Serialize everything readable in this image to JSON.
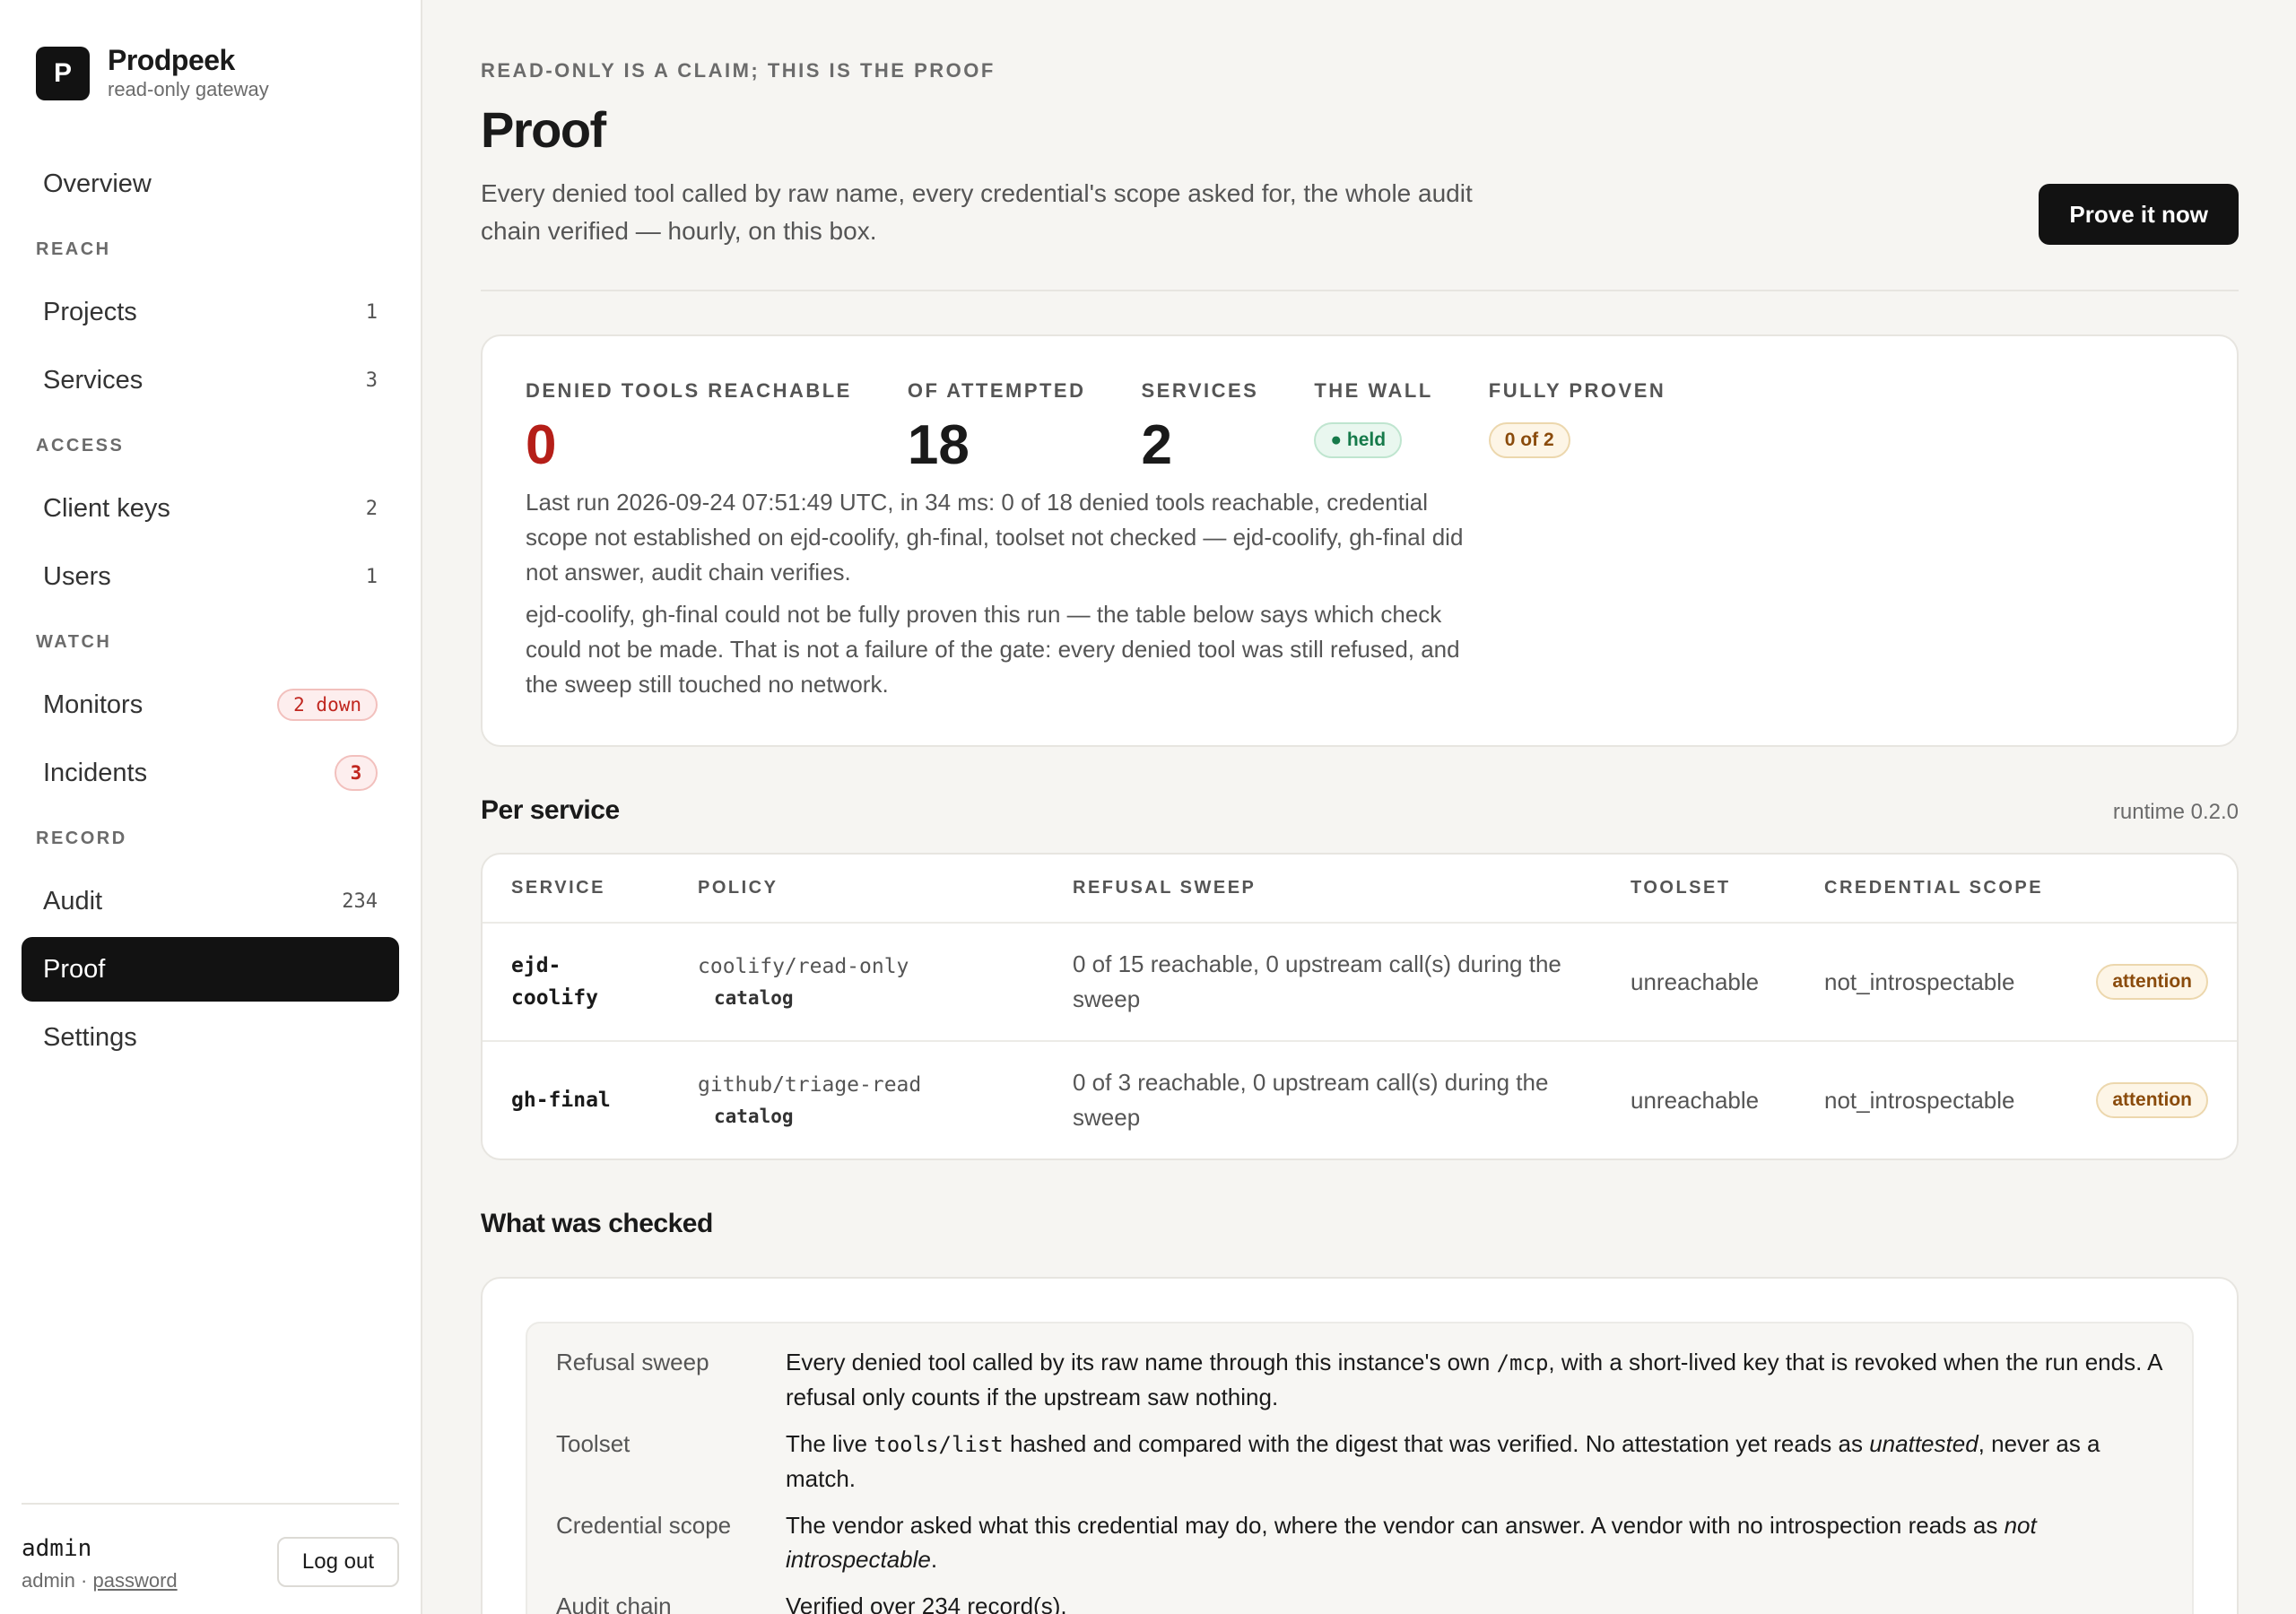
{
  "brand": {
    "logo": "P",
    "name": "Prodpeek",
    "subtitle": "read-only gateway"
  },
  "nav": {
    "overview": "Overview",
    "sections": {
      "reach": "REACH",
      "access": "ACCESS",
      "watch": "WATCH",
      "record": "RECORD"
    },
    "projects": {
      "label": "Projects",
      "count": "1"
    },
    "services": {
      "label": "Services",
      "count": "3"
    },
    "client_keys": {
      "label": "Client keys",
      "count": "2"
    },
    "users": {
      "label": "Users",
      "count": "1"
    },
    "monitors": {
      "label": "Monitors",
      "badge": "2 down"
    },
    "incidents": {
      "label": "Incidents",
      "badge": "3"
    },
    "audit": {
      "label": "Audit",
      "count": "234"
    },
    "proof": {
      "label": "Proof"
    },
    "settings": {
      "label": "Settings"
    }
  },
  "user": {
    "name": "admin",
    "role": "admin",
    "sep": " · ",
    "password_link": "password",
    "logout": "Log out"
  },
  "page": {
    "eyebrow": "READ-ONLY IS A CLAIM; THIS IS THE PROOF",
    "title": "Proof",
    "description": "Every denied tool called by raw name, every credential's scope asked for, the whole audit chain verified — hourly, on this box.",
    "action": "Prove it now"
  },
  "summary": {
    "stats": [
      {
        "label": "DENIED TOOLS REACHABLE",
        "value": "0"
      },
      {
        "label": "OF ATTEMPTED",
        "value": "18"
      },
      {
        "label": "SERVICES",
        "value": "2"
      },
      {
        "label": "THE WALL",
        "badge": "● held"
      },
      {
        "label": "FULLY PROVEN",
        "badge": "0 of 2"
      }
    ],
    "last_run": "Last run 2026-09-24 07:51:49 UTC, in 34 ms: 0 of 18 denied tools reachable, credential scope not established on ejd-coolify, gh-final, toolset not checked — ejd-coolify, gh-final did not answer, audit chain verifies.",
    "note": "ejd-coolify, gh-final could not be fully proven this run — the table below says which check could not be made. That is not a failure of the gate: every denied tool was still refused, and the sweep still touched no network."
  },
  "per_service": {
    "title": "Per service",
    "runtime": "runtime 0.2.0",
    "columns": [
      "SERVICE",
      "POLICY",
      "REFUSAL SWEEP",
      "TOOLSET",
      "CREDENTIAL SCOPE"
    ],
    "rows": [
      {
        "service": "ejd-coolify",
        "policy": "coolify/read-only",
        "policy_sub": "catalog",
        "sweep": "0 of 15 reachable, 0 upstream call(s) during the sweep",
        "toolset": "unreachable",
        "scope": "not_introspectable",
        "status": "attention"
      },
      {
        "service": "gh-final",
        "policy": "github/triage-read",
        "policy_sub": "catalog",
        "sweep": "0 of 3 reachable, 0 upstream call(s) during the sweep",
        "toolset": "unreachable",
        "scope": "not_introspectable",
        "status": "attention"
      }
    ]
  },
  "checked": {
    "title": "What was checked",
    "refusal_sweep": {
      "key": "Refusal sweep",
      "pre": "Every denied tool called by its raw name through this instance's own ",
      "code": "/mcp",
      "post": ", with a short-lived key that is revoked when the run ends. A refusal only counts if the upstream saw nothing."
    },
    "toolset": {
      "key": "Toolset",
      "pre": "The live ",
      "code": "tools/list",
      "mid": " hashed and compared with the digest that was verified. No attestation yet reads as ",
      "em": "unattested",
      "post": ", never as a match."
    },
    "credential_scope": {
      "key": "Credential scope",
      "pre": "The vendor asked what this credential may do, where the vendor can answer. A vendor with no introspection reads as ",
      "em": "not introspectable",
      "post": "."
    },
    "audit_chain": {
      "key": "Audit chain",
      "val": "Verified over 234 record(s)."
    }
  }
}
